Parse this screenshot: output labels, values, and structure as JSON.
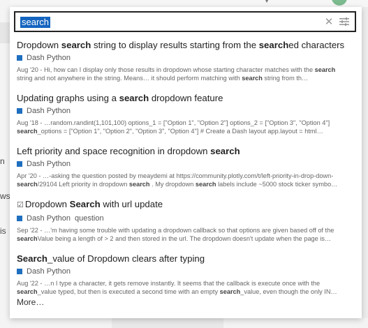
{
  "search": {
    "query": "search"
  },
  "results": [
    {
      "title_parts": [
        [
          "t",
          "Dropdown "
        ],
        [
          "b",
          "search"
        ],
        [
          "t",
          " string to display results starting from the "
        ],
        [
          "b",
          "search"
        ],
        [
          "t",
          "ed characters"
        ]
      ],
      "category": "Dash Python",
      "tags": [],
      "blurb_parts": [
        [
          "t",
          "Aug '20 - Hi, how can I display only those results in dropdown whose starting character matches with the "
        ],
        [
          "b",
          "search"
        ],
        [
          "t",
          " string and not anywhere in the string. Means… it should perform matching with "
        ],
        [
          "b",
          "search"
        ],
        [
          "t",
          " string from th…"
        ]
      ]
    },
    {
      "title_parts": [
        [
          "t",
          "Updating graphs using a "
        ],
        [
          "b",
          "search"
        ],
        [
          "t",
          " dropdown feature"
        ]
      ],
      "category": "Dash Python",
      "tags": [],
      "blurb_parts": [
        [
          "t",
          "Aug '18 - …random.randint(1,101,100) options_1 = [\"Option 1\", \"Option 2\"] options_2 = [\"Option 3\", \"Option 4\"] "
        ],
        [
          "b",
          "search"
        ],
        [
          "t",
          "_options = [\"Option 1\", \"Option 2\", \"Option 3\", \"Option 4\"] # Create a Dash layout app.layout = html…"
        ]
      ]
    },
    {
      "title_parts": [
        [
          "t",
          "Left priority and space recognition in dropdown "
        ],
        [
          "b",
          "search"
        ]
      ],
      "category": "Dash Python",
      "tags": [],
      "blurb_parts": [
        [
          "t",
          "Apr '20 - …-asking the question posted by meaydemi at https://community.plotly.com/t/left-priority-in-drop-down-"
        ],
        [
          "b",
          "search"
        ],
        [
          "t",
          "/29104 Left priority in dropdown "
        ],
        [
          "b",
          "search"
        ],
        [
          "t",
          " . My dropdown "
        ],
        [
          "b",
          "search"
        ],
        [
          "t",
          " labels include ~5000 stock ticker symbo…"
        ]
      ]
    },
    {
      "checkbox": true,
      "title_parts": [
        [
          "t",
          "Dropdown "
        ],
        [
          "b",
          "Search"
        ],
        [
          "t",
          " with url update"
        ]
      ],
      "category": "Dash Python",
      "tags": [
        "question"
      ],
      "blurb_parts": [
        [
          "t",
          "Sep '22 - …'m having some trouble with updating a dropdown callback so that options are given based off of the "
        ],
        [
          "b",
          "search"
        ],
        [
          "t",
          "Value being a length of > 2 and then stored in the url. The dropdown doesn't update when the page is…"
        ]
      ]
    },
    {
      "title_parts": [
        [
          "b",
          "Search"
        ],
        [
          "t",
          "_value of Dropdown clears after typing"
        ]
      ],
      "category": "Dash Python",
      "tags": [],
      "blurb_parts": [
        [
          "t",
          "Aug '22 - …n I type a character, it gets remove instantly. It seems that the callback is execute once with the "
        ],
        [
          "b",
          "search"
        ],
        [
          "t",
          "_value typed, but then is executed a second time with an empty "
        ],
        [
          "b",
          "search"
        ],
        [
          "t",
          "_value, even though the only IN…"
        ]
      ]
    }
  ],
  "more_label": "More…",
  "background": {
    "frag_n": "n",
    "frag_ws": "ws",
    "frag_is": "is"
  },
  "colors": {
    "category_square": "#1f6fbf",
    "selection": "#1565c0"
  }
}
